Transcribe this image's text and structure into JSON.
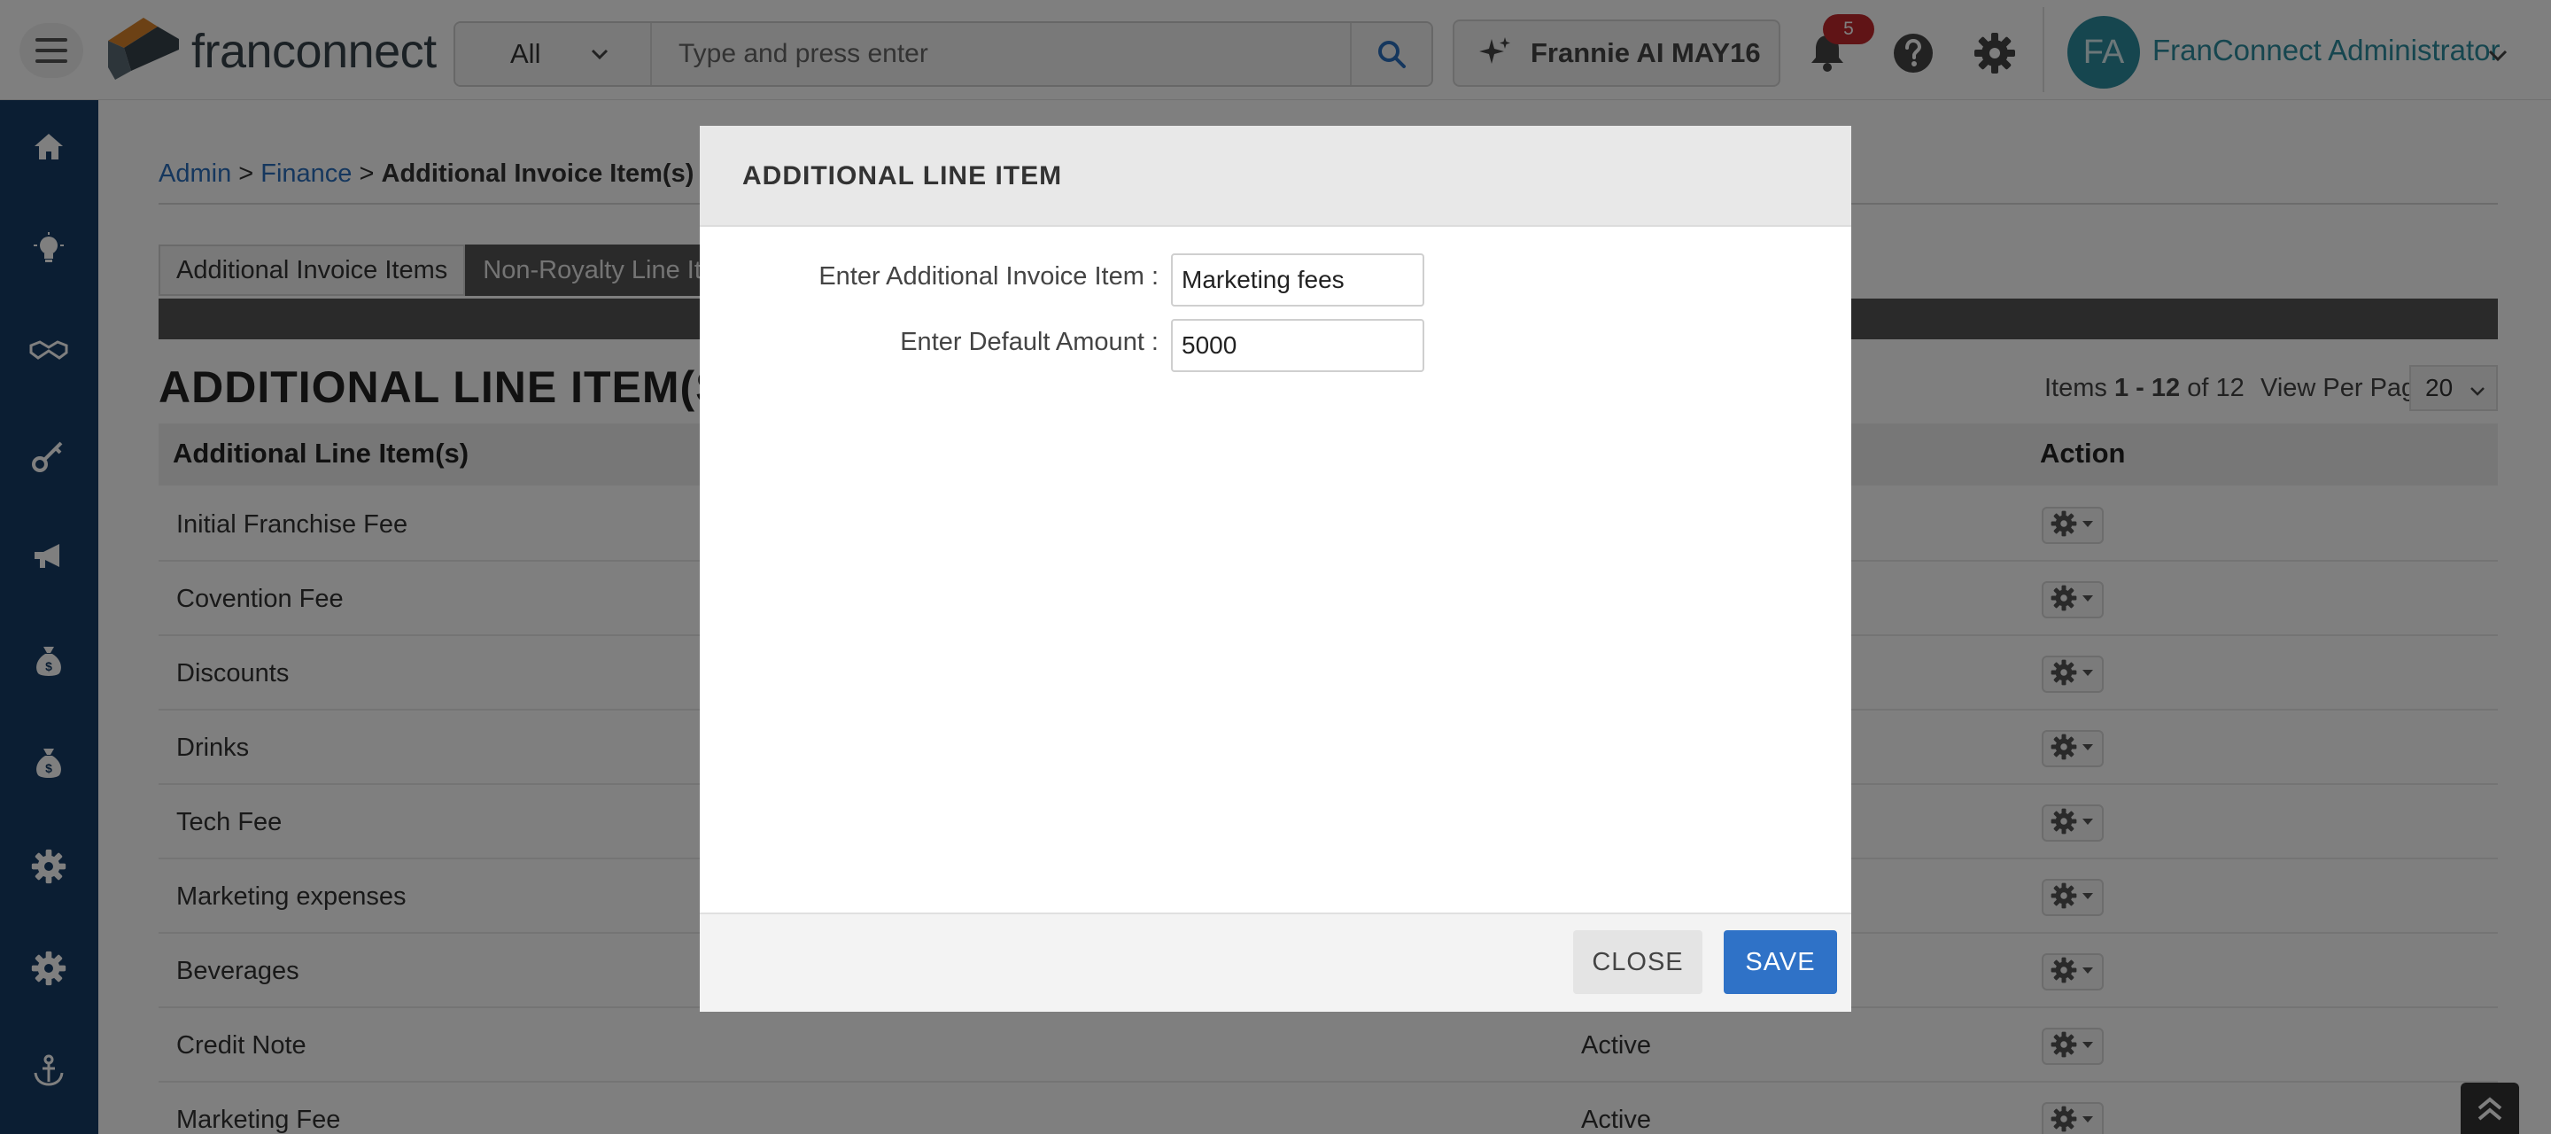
{
  "header": {
    "logo_text": "franconnect",
    "search_scope": "All",
    "search_placeholder": "Type and press enter",
    "frannie_label": "Frannie AI MAY16",
    "notification_count": "5",
    "avatar_initials": "FA",
    "username": "FranConnect Administrator"
  },
  "sidebar": {
    "items": [
      {
        "icon": "home-icon"
      },
      {
        "icon": "lightbulb-icon"
      },
      {
        "icon": "handshake-icon"
      },
      {
        "icon": "key-icon"
      },
      {
        "icon": "megaphone-icon"
      },
      {
        "icon": "money-bag-icon"
      },
      {
        "icon": "money-bag-icon"
      },
      {
        "icon": "gear-icon"
      },
      {
        "icon": "gear-icon"
      },
      {
        "icon": "ship-icon"
      }
    ]
  },
  "breadcrumb": {
    "admin": "Admin",
    "finance": "Finance",
    "current": "Additional Invoice Item(s)",
    "sep": ">"
  },
  "tabs": [
    {
      "label": "Additional Invoice Items",
      "active": false
    },
    {
      "label": "Non-Royalty Line Items",
      "active": true
    }
  ],
  "page": {
    "title": "ADDITIONAL LINE ITEM(S)",
    "items_prefix": "Items ",
    "items_range": "1 - 12",
    "items_of": " of 12",
    "view_per_page_label": "View Per Page",
    "per_page_value": "20"
  },
  "table": {
    "columns": {
      "name": "Additional Line Item(s)",
      "action": "Action"
    },
    "rows": [
      {
        "name": "Initial Franchise Fee",
        "status": ""
      },
      {
        "name": "Covention Fee",
        "status": ""
      },
      {
        "name": "Discounts",
        "status": ""
      },
      {
        "name": "Drinks",
        "status": ""
      },
      {
        "name": "Tech Fee",
        "status": ""
      },
      {
        "name": "Marketing expenses",
        "status": ""
      },
      {
        "name": "Beverages",
        "status": ""
      },
      {
        "name": "Credit Note",
        "status": "Active"
      },
      {
        "name": "Marketing Fee",
        "status": "Active"
      }
    ]
  },
  "modal": {
    "title": "ADDITIONAL LINE ITEM",
    "item_label": "Enter Additional Invoice Item :",
    "item_value": "Marketing fees",
    "amount_label": "Enter Default Amount :",
    "amount_value": "5000",
    "close_label": "CLOSE",
    "save_label": "SAVE"
  },
  "colors": {
    "sidebar_bg": "#173c66",
    "primary_button": "#2f72c7",
    "link": "#2a6ebd",
    "badge": "#c0282d",
    "avatar_bg": "#2d8c9e"
  }
}
